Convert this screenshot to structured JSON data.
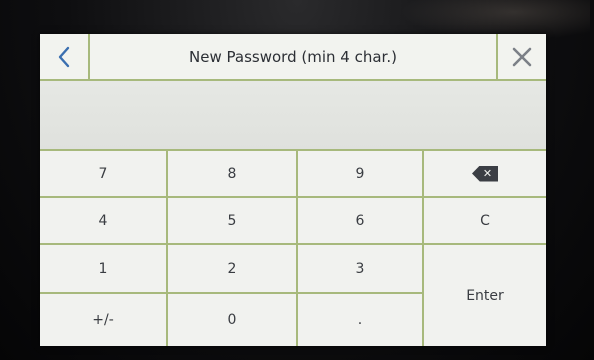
{
  "header": {
    "title": "New Password (min 4 char.)"
  },
  "display": {
    "value": ""
  },
  "keypad": {
    "row1": [
      "7",
      "8",
      "9"
    ],
    "row2": [
      "4",
      "5",
      "6"
    ],
    "row3": [
      "1",
      "2",
      "3"
    ],
    "row4": [
      "+/-",
      "0",
      "."
    ],
    "clear_label": "C",
    "enter_label": "Enter",
    "backspace_glyph": "✕"
  },
  "icons": {
    "back": "chevron-left-icon",
    "close": "close-icon",
    "backspace": "backspace-icon"
  },
  "colors": {
    "grid_lines": "#a7b97c",
    "back_chevron": "#3b6fb0",
    "close_x": "#7c8087",
    "text": "#3a3d42"
  }
}
